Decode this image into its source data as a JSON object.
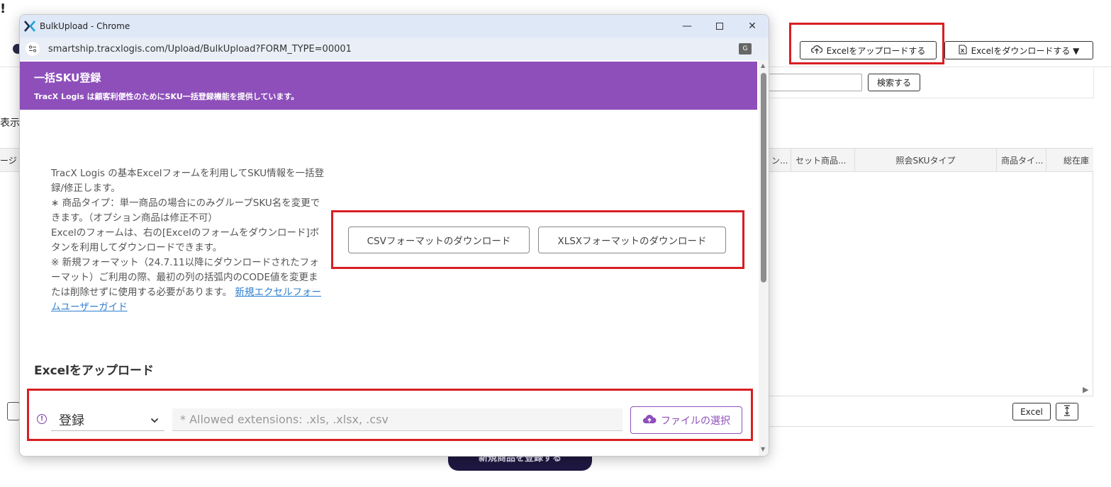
{
  "background": {
    "mark": "!",
    "upload_excel_label": "Excelをアップロードする",
    "download_excel_label": "Excelをダウンロードする ▼",
    "search_label": "検索する",
    "side_text_1": "表示",
    "side_text_2": "ージ",
    "table_headers": [
      "ン...",
      "セット商品...",
      "照会SKUタイプ",
      "商品タイ...",
      "総在庫"
    ],
    "excel_small_label": "Excel",
    "primary_button_label": "新規商品を登録する"
  },
  "window": {
    "title": "BulkUpload - Chrome",
    "url": "smartship.tracxlogis.com/Upload/BulkUpload?FORM_TYPE=00001"
  },
  "header": {
    "title": "一括SKU登録",
    "subtitle": "TracX Logis は顧客利便性のためにSKU一括登録機能を提供しています。"
  },
  "description": {
    "text": "TracX Logis の基本Excelフォームを利用してSKU情報を一括登録/修正します。\n∗ 商品タイプ：単一商品の場合にのみグループSKU名を変更できます。（オプション商品は修正不可）\nExcelのフォームは、右の[Excelのフォームをダウンロード]ボタンを利用してダウンロードできます。\n※ 新規フォーマット（24.7.11以降にダウンロードされたフォーマット）ご利用の際、最初の列の括弧内のCODE値を変更または削除せずに使用する必要があります。 ",
    "link_text": "新規エクセルフォームユーザーガイド"
  },
  "downloads": {
    "csv_label": "CSVフォーマットのダウンロード",
    "xlsx_label": "XLSXフォーマットのダウンロード"
  },
  "upload": {
    "section_title": "Excelをアップロード",
    "mode_selected": "登録",
    "file_placeholder": "* Allowed extensions: .xls, .xlsx, .csv",
    "file_button_label": "ファイルの選択"
  },
  "colors": {
    "accent_purple": "#8e4fbb",
    "highlight_red": "#d81e23",
    "primary_dark": "#1f1842"
  }
}
